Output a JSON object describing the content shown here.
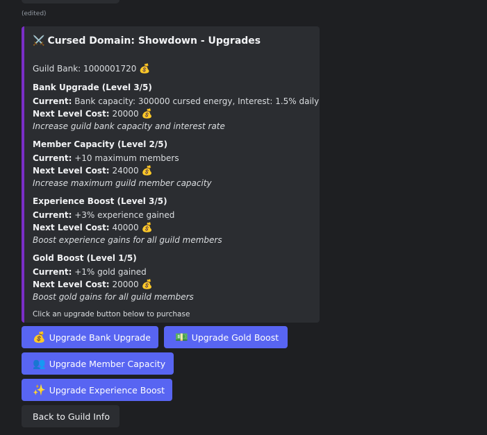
{
  "message": {
    "edited_label": "(edited)"
  },
  "embed": {
    "title_icon": "⚔️",
    "title": "Cursed Domain: Showdown - Upgrades",
    "guild_bank_label": "Guild Bank: 1000001720",
    "coin_icon": "💰",
    "accent_color": "#7a2ec7",
    "upgrades": [
      {
        "heading": "Bank Upgrade (Level 3/5)",
        "current_label": "Current:",
        "current_value": "Bank capacity: 300000 cursed energy, Interest: 1.5% daily",
        "cost_label": "Next Level Cost:",
        "cost_value": "20000",
        "description": "Increase guild bank capacity and interest rate"
      },
      {
        "heading": "Member Capacity (Level 2/5)",
        "current_label": "Current:",
        "current_value": "+10 maximum members",
        "cost_label": "Next Level Cost:",
        "cost_value": "24000",
        "description": "Increase maximum guild member capacity"
      },
      {
        "heading": "Experience Boost (Level 3/5)",
        "current_label": "Current:",
        "current_value": "+3% experience gained",
        "cost_label": "Next Level Cost:",
        "cost_value": "40000",
        "description": "Boost experience gains for all guild members"
      },
      {
        "heading": "Gold Boost (Level 1/5)",
        "current_label": "Current:",
        "current_value": "+1% gold gained",
        "cost_label": "Next Level Cost:",
        "cost_value": "20000",
        "description": "Boost gold gains for all guild members"
      }
    ],
    "footer": "Click an upgrade button below to purchase"
  },
  "buttons": {
    "bank": {
      "icon": "💰",
      "label": "Upgrade Bank Upgrade"
    },
    "gold": {
      "icon": "💵",
      "label": "Upgrade Gold Boost"
    },
    "member": {
      "icon": "👥",
      "label": "Upgrade Member Capacity"
    },
    "experience": {
      "icon": "✨",
      "label": "Upgrade Experience Boost"
    },
    "back": {
      "label": "Back to Guild Info"
    }
  },
  "colors": {
    "primary_button": "#5865f2",
    "secondary_button": "#2b2d31",
    "background": "#1e1f22",
    "embed_background": "#2b2d31"
  }
}
